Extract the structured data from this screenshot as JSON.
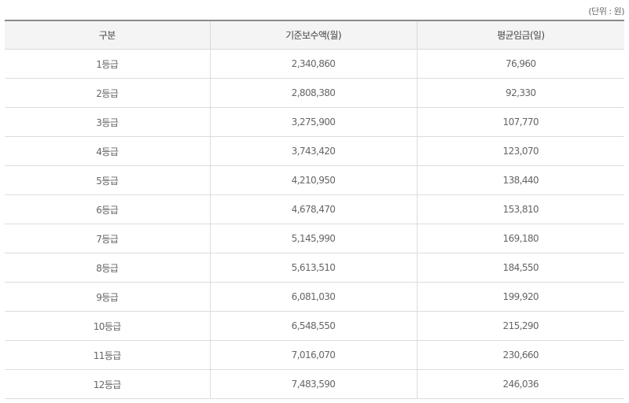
{
  "unit_note": "(단위 : 원)",
  "table": {
    "headers": [
      "구분",
      "기준보수액(월)",
      "평균임금(일)"
    ],
    "rows": [
      [
        "1등급",
        "2,340,860",
        "76,960"
      ],
      [
        "2등급",
        "2,808,380",
        "92,330"
      ],
      [
        "3등급",
        "3,275,900",
        "107,770"
      ],
      [
        "4등급",
        "3,743,420",
        "123,070"
      ],
      [
        "5등급",
        "4,210,950",
        "138,440"
      ],
      [
        "6등급",
        "4,678,470",
        "153,810"
      ],
      [
        "7등급",
        "5,145,990",
        "169,180"
      ],
      [
        "8등급",
        "5,613,510",
        "184,550"
      ],
      [
        "9등급",
        "6,081,030",
        "199,920"
      ],
      [
        "10등급",
        "6,548,550",
        "215,290"
      ],
      [
        "11등급",
        "7,016,070",
        "230,660"
      ],
      [
        "12등급",
        "7,483,590",
        "246,036"
      ]
    ]
  }
}
